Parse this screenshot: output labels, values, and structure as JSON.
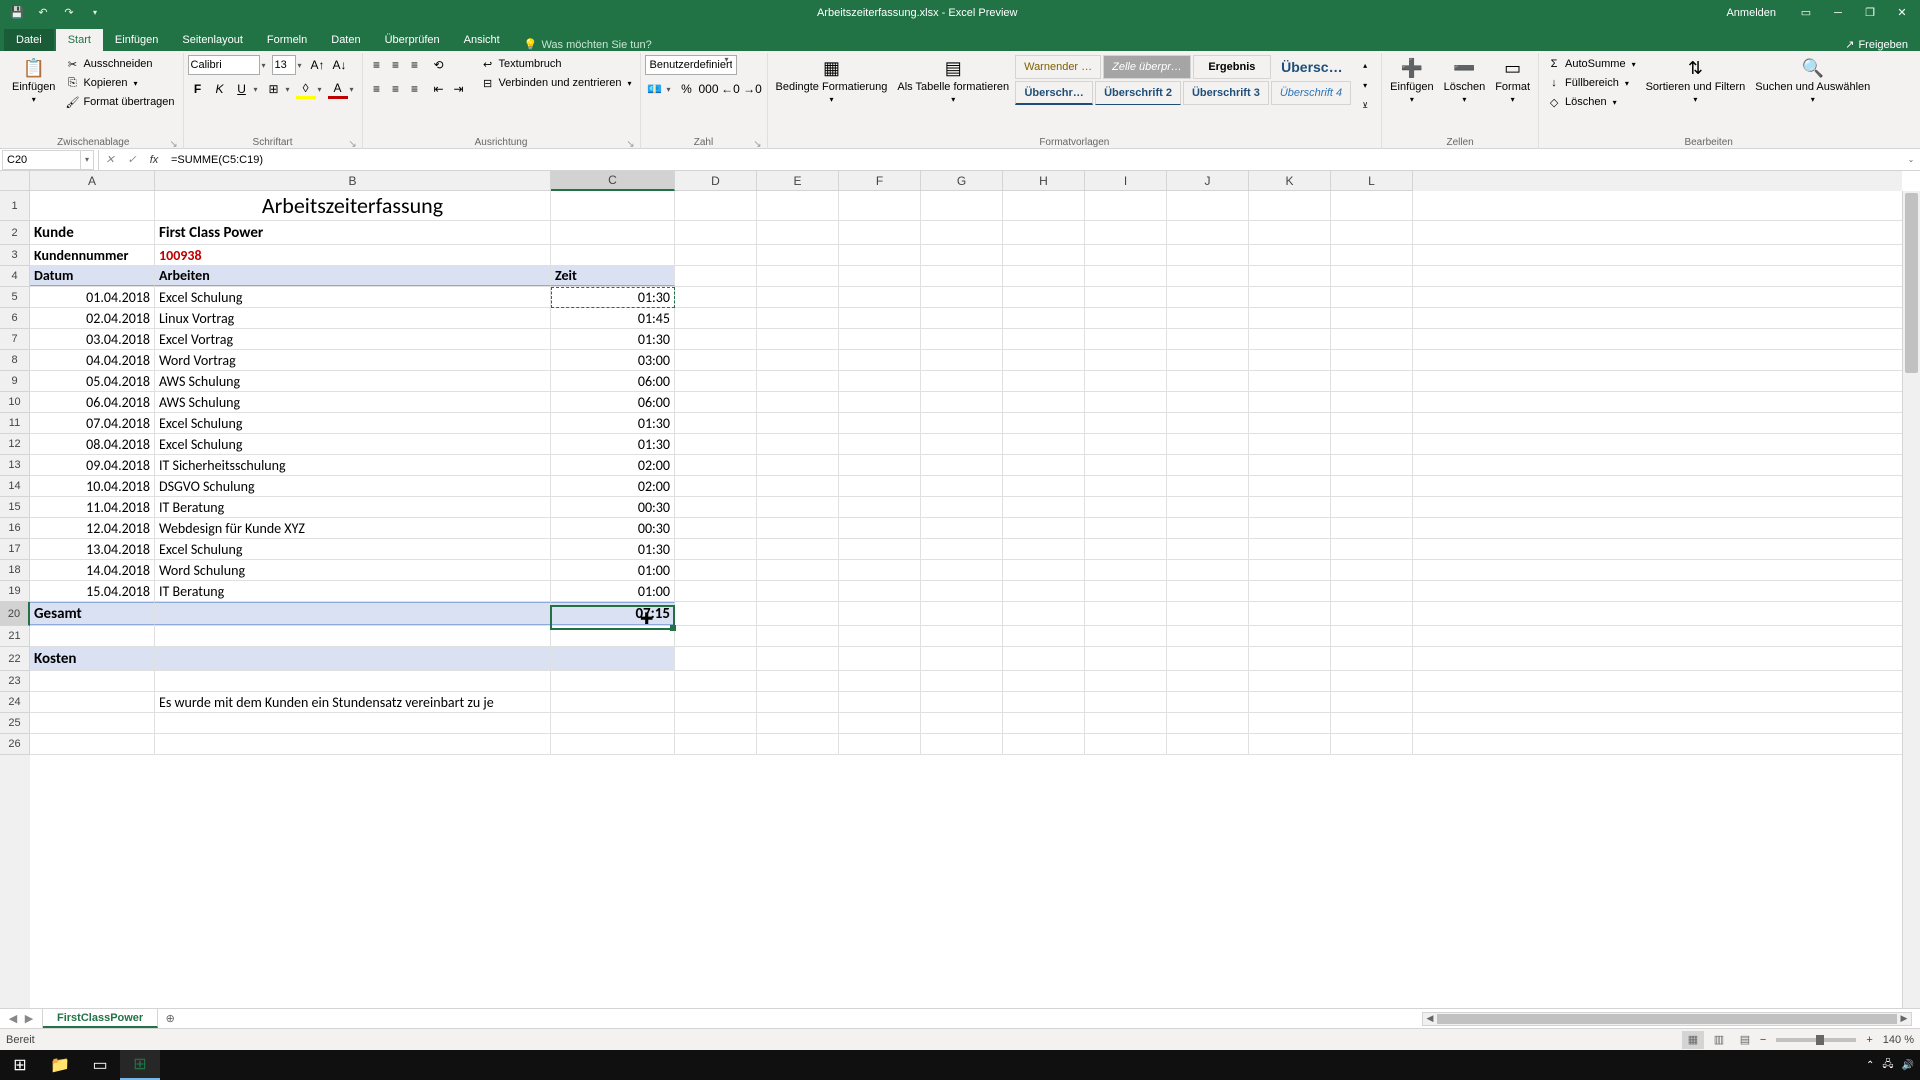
{
  "window": {
    "title": "Arbeitszeiterfassung.xlsx - Excel Preview",
    "signin": "Anmelden"
  },
  "tabs": {
    "file": "Datei",
    "home": "Start",
    "insert": "Einfügen",
    "layout": "Seitenlayout",
    "formulas": "Formeln",
    "data": "Daten",
    "review": "Überprüfen",
    "view": "Ansicht",
    "tellme": "Was möchten Sie tun?",
    "share": "Freigeben"
  },
  "ribbon": {
    "clipboard": {
      "label": "Zwischenablage",
      "paste": "Einfügen",
      "cut": "Ausschneiden",
      "copy": "Kopieren",
      "painter": "Format übertragen"
    },
    "font": {
      "label": "Schriftart",
      "name": "Calibri",
      "size": "13"
    },
    "align": {
      "label": "Ausrichtung",
      "wrap": "Textumbruch",
      "merge": "Verbinden und zentrieren"
    },
    "number": {
      "label": "Zahl",
      "format": "Benutzerdefiniert"
    },
    "styles": {
      "label": "Formatvorlagen",
      "cond": "Bedingte Formatierung",
      "table": "Als Tabelle formatieren",
      "warn": "Warnender …",
      "check": "Zelle überpr…",
      "result": "Ergebnis",
      "title": "Übersc…",
      "h1": "Überschr…",
      "h2": "Überschrift 2",
      "h3": "Überschrift 3",
      "h4": "Überschrift 4"
    },
    "cells": {
      "label": "Zellen",
      "insert": "Einfügen",
      "delete": "Löschen",
      "format": "Format"
    },
    "editing": {
      "label": "Bearbeiten",
      "sum": "AutoSumme",
      "fill": "Füllbereich",
      "clear": "Löschen",
      "sort": "Sortieren und Filtern",
      "find": "Suchen und Auswählen"
    }
  },
  "formula_bar": {
    "ref": "C20",
    "formula": "=SUMME(C5:C19)"
  },
  "columns": [
    "A",
    "B",
    "C",
    "D",
    "E",
    "F",
    "G",
    "H",
    "I",
    "J",
    "K",
    "L"
  ],
  "sheet": {
    "title": "Arbeitszeiterfassung",
    "kunde_label": "Kunde",
    "kunde_value": "First Class Power",
    "nr_label": "Kundennummer",
    "nr_value": "100938",
    "hdr_date": "Datum",
    "hdr_work": "Arbeiten",
    "hdr_time": "Zeit",
    "rows": [
      {
        "d": "01.04.2018",
        "w": "Excel Schulung",
        "t": "01:30"
      },
      {
        "d": "02.04.2018",
        "w": "Linux Vortrag",
        "t": "01:45"
      },
      {
        "d": "03.04.2018",
        "w": "Excel Vortrag",
        "t": "01:30"
      },
      {
        "d": "04.04.2018",
        "w": "Word Vortrag",
        "t": "03:00"
      },
      {
        "d": "05.04.2018",
        "w": "AWS Schulung",
        "t": "06:00"
      },
      {
        "d": "06.04.2018",
        "w": "AWS Schulung",
        "t": "06:00"
      },
      {
        "d": "07.04.2018",
        "w": "Excel Schulung",
        "t": "01:30"
      },
      {
        "d": "08.04.2018",
        "w": "Excel Schulung",
        "t": "01:30"
      },
      {
        "d": "09.04.2018",
        "w": "IT Sicherheitsschulung",
        "t": "02:00"
      },
      {
        "d": "10.04.2018",
        "w": "DSGVO Schulung",
        "t": "02:00"
      },
      {
        "d": "11.04.2018",
        "w": "IT Beratung",
        "t": "00:30"
      },
      {
        "d": "12.04.2018",
        "w": "Webdesign für Kunde XYZ",
        "t": "00:30"
      },
      {
        "d": "13.04.2018",
        "w": "Excel Schulung",
        "t": "01:30"
      },
      {
        "d": "14.04.2018",
        "w": "Word Schulung",
        "t": "01:00"
      },
      {
        "d": "15.04.2018",
        "w": "IT Beratung",
        "t": "01:00"
      }
    ],
    "total_label": "Gesamt",
    "total_value": "07:15",
    "kosten": "Kosten",
    "note": "Es wurde mit dem Kunden ein Stundensatz vereinbart zu je"
  },
  "sheet_tab": "FirstClassPower",
  "status": {
    "ready": "Bereit",
    "zoom": "140 %"
  }
}
